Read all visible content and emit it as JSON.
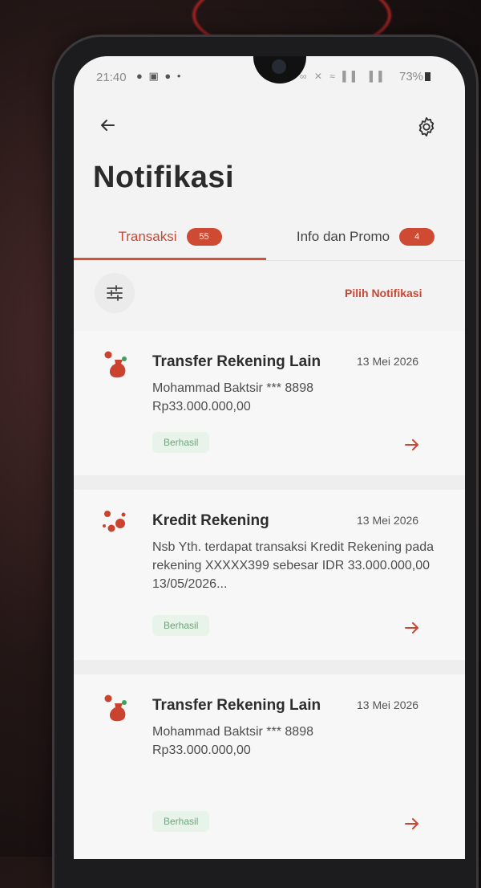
{
  "status_bar": {
    "time": "21:40",
    "left_icons": "● ▣ ● •",
    "right_icons": "∞ ✕ ≈ ▌▌ ▐▐",
    "battery": "73%"
  },
  "header": {
    "title": "Notifikasi"
  },
  "tabs": [
    {
      "label": "Transaksi",
      "badge": "55",
      "active": true
    },
    {
      "label": "Info dan Promo",
      "badge": "4",
      "active": false
    }
  ],
  "toolbar": {
    "select_label": "Pilih Notifikasi"
  },
  "notifications": [
    {
      "title": "Transfer Rekening Lain",
      "date": "13 Mei 2026",
      "body": "Mohammad Baktsir *** 8898\nRp33.000.000,00",
      "status": "Berhasil",
      "icon": "money-bag-icon"
    },
    {
      "title": "Kredit Rekening",
      "date": "13 Mei 2026",
      "body": "Nsb Yth. terdapat transaksi Kredit Rekening pada rekening XXXXX399 sebesar IDR 33.000.000,00 13/05/2026...",
      "status": "Berhasil",
      "icon": "coins-icon"
    },
    {
      "title": "Transfer Rekening Lain",
      "date": "13 Mei 2026",
      "body": "Mohammad Baktsir *** 8898\nRp33.000.000,00",
      "status": "Berhasil",
      "icon": "money-bag-icon"
    }
  ],
  "colors": {
    "accent": "#d2513b",
    "success_bg": "#e8f3ea",
    "success_text": "#6aa77a"
  }
}
